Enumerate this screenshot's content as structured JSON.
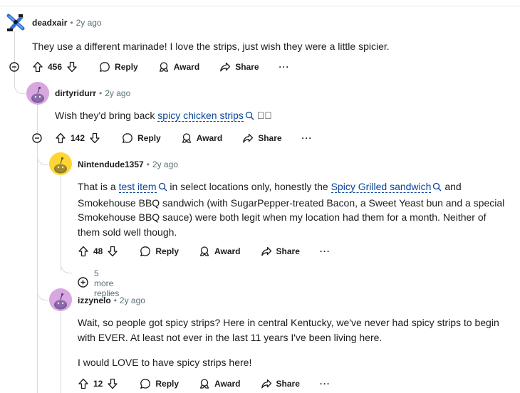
{
  "comments": [
    {
      "username": "deadxair",
      "age": "2y ago",
      "text": "They use a different marinade! I love the strips, just wish they were a little spicier.",
      "score": "456",
      "reply": "Reply",
      "award": "Award",
      "share": "Share"
    },
    {
      "username": "dirtyridurr",
      "age": "2y ago",
      "text_prefix": "Wish they'd bring back ",
      "link_text": "spicy chicken strips",
      "text_suffix": " ⃞⃞",
      "score": "142",
      "reply": "Reply",
      "award": "Award",
      "share": "Share"
    },
    {
      "username": "Nintendude1357",
      "age": "2y ago",
      "text_1": "That is a ",
      "link_1": "test item",
      "text_2": " in select locations only, honestly the ",
      "link_2": "Spicy Grilled sandwich",
      "text_3": " and Smokehouse BBQ sandwich (with SugarPepper-treated Bacon, a Sweet Yeast bun and a special Smokehouse BBQ sauce) were both legit when my location had them for a month. Neither of them sold well though.",
      "score": "48",
      "reply": "Reply",
      "award": "Award",
      "share": "Share",
      "more_replies": "5 more replies"
    },
    {
      "username": "izzynelo",
      "age": "2y ago",
      "text_p1": "Wait, so people got spicy strips? Here in central Kentucky, we've never had spicy strips to begin with EVER. At least not ever in the last 11 years I've been living here.",
      "text_p2": "I would LOVE to have spicy strips here!",
      "score": "12",
      "reply": "Reply",
      "award": "Award",
      "share": "Share"
    }
  ],
  "colors": {
    "link": "#0a449b",
    "meta": "#576f76",
    "thread": "#d7dadc",
    "avatar_pink": "#d9a7e0",
    "avatar_yellow": "#ffd635"
  }
}
